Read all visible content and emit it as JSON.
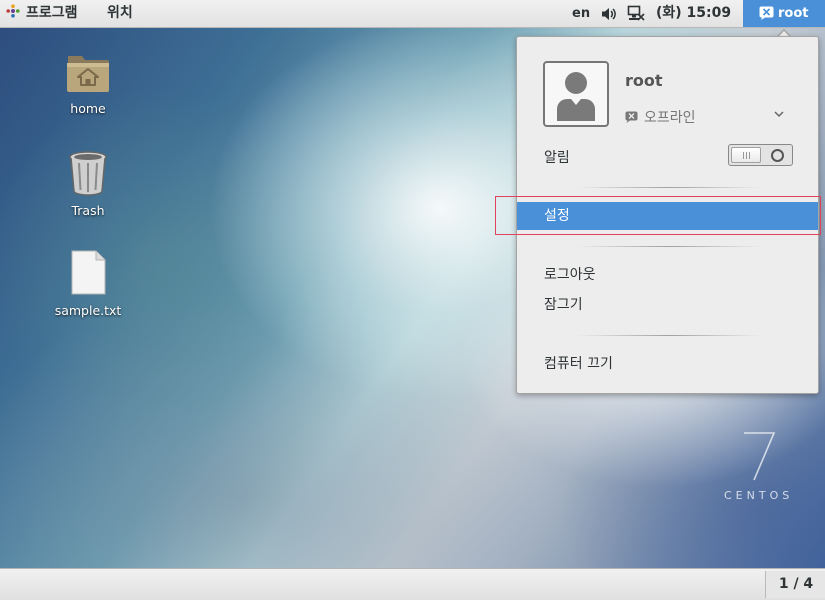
{
  "top_bar": {
    "applications_label": "프로그램",
    "places_label": "위치",
    "keyboard_layout": "en",
    "clock": "(화) 15:09",
    "user_label": "root"
  },
  "desktop": {
    "icons": [
      {
        "label": "home",
        "icon": "folder-home-icon"
      },
      {
        "label": "Trash",
        "icon": "trash-icon"
      },
      {
        "label": "sample.txt",
        "icon": "text-file-icon"
      }
    ],
    "wallpaper_logo_number": "7",
    "wallpaper_logo_text": "CENTOS"
  },
  "user_menu": {
    "user_name": "root",
    "presence_status": "오프라인",
    "notifications_label": "알림",
    "notifications_enabled": false,
    "items": {
      "settings": "설정",
      "logout": "로그아웃",
      "lock": "잠그기",
      "power_off": "컴퓨터 끄기"
    },
    "selected_item": "settings"
  },
  "bottom_bar": {
    "workspace_indicator": "1 / 4"
  },
  "colors": {
    "accent": "#4a90d9",
    "highlight_border": "#e0435a",
    "panel_bg": "#ededed"
  }
}
